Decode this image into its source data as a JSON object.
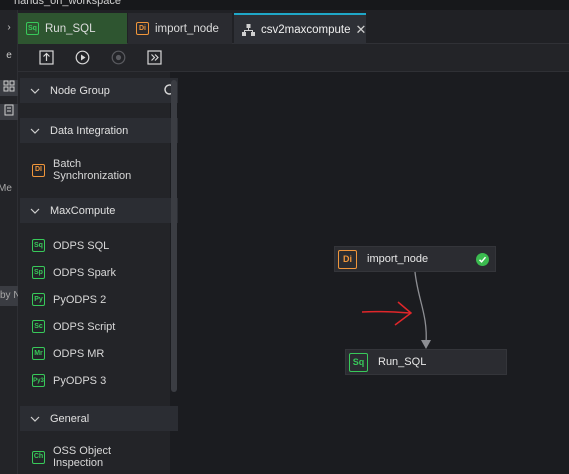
{
  "window": {
    "title": "hands_on_workspace"
  },
  "left_strip": {
    "label_me": "Me",
    "label_by": "by N"
  },
  "tabs": [
    {
      "label": "Run_SQL",
      "icon": "Sq",
      "active": false
    },
    {
      "label": "import_node",
      "icon": "Di",
      "active": false
    },
    {
      "label": "csv2maxcompute",
      "active": true
    }
  ],
  "toolbar": {
    "buttons": [
      "submit-icon",
      "run-icon",
      "stop-icon",
      "go-to-ops-icon"
    ]
  },
  "panel": {
    "node_group": "Node Group",
    "data_integration": "Data Integration",
    "batch_sync": {
      "icon": "DI",
      "label1": "Batch",
      "label2": "Synchronization"
    },
    "maxcompute": "MaxCompute",
    "items": [
      {
        "icon": "Sq",
        "label": "ODPS SQL"
      },
      {
        "icon": "Sp",
        "label": "ODPS Spark"
      },
      {
        "icon": "Py",
        "label": "PyODPS 2"
      },
      {
        "icon": "Sc",
        "label": "ODPS Script"
      },
      {
        "icon": "Mr",
        "label": "ODPS MR"
      },
      {
        "icon": "Py3",
        "label": "PyODPS 3"
      }
    ],
    "general": "General",
    "oss": {
      "icon": "Ch",
      "label1": "OSS Object",
      "label2": "Inspection"
    }
  },
  "canvas": {
    "node1": {
      "icon": "Di",
      "label": "import_node",
      "status": "success"
    },
    "node2": {
      "icon": "Sq",
      "label": "Run_SQL"
    }
  },
  "colors": {
    "accent": "#1fa7c8",
    "green": "#38c95a",
    "orange": "#f0963b",
    "annotation_red": "#e0262a"
  }
}
